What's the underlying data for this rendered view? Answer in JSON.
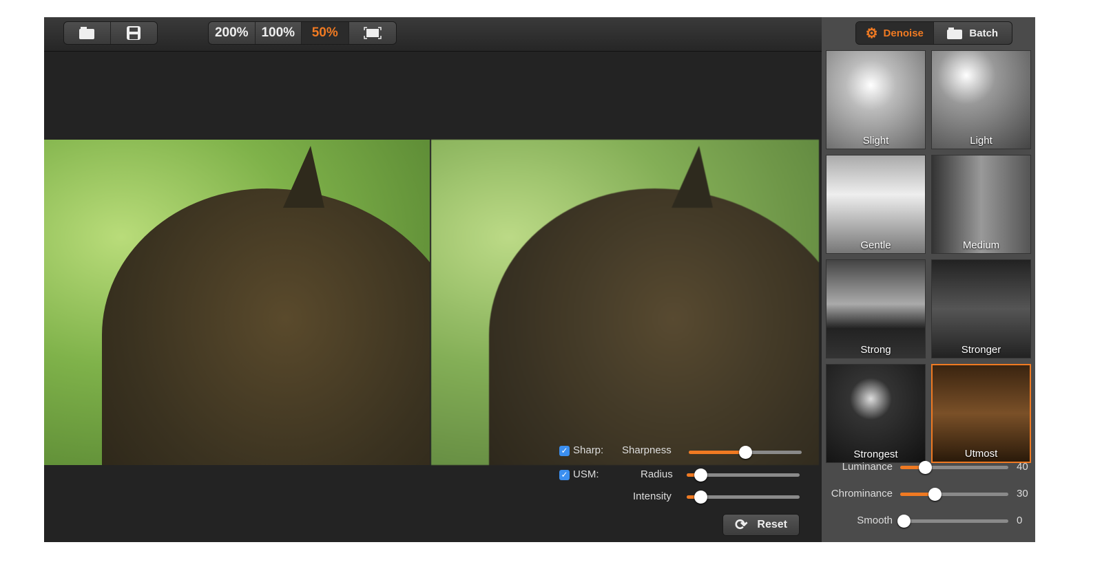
{
  "toolbar": {
    "open_icon": "folder-icon",
    "save_icon": "floppy-disk-icon",
    "zoom": [
      "200%",
      "100%",
      "50%"
    ],
    "active_zoom": "50%",
    "fit_icon": "fit-screen-icon"
  },
  "mode_tabs": {
    "denoise": "Denoise",
    "batch": "Batch",
    "active": "Denoise"
  },
  "sharp": {
    "checkbox_label": "Sharp:",
    "checked": true,
    "sharpness_label": "Sharpness",
    "sharpness": 50
  },
  "usm": {
    "checkbox_label": "USM:",
    "checked": true,
    "radius_label": "Radius",
    "radius": 12,
    "intensity_label": "Intensity",
    "intensity": 12
  },
  "reset_label": "Reset",
  "presets": [
    "Slight",
    "Light",
    "Gentle",
    "Medium",
    "Strong",
    "Stronger",
    "Strongest",
    "Utmost"
  ],
  "selected_preset": "Utmost",
  "denoise_sliders": [
    {
      "label": "Luminance",
      "value": "40",
      "position": 23
    },
    {
      "label": "Chrominance",
      "value": "30",
      "position": 32
    },
    {
      "label": "Smooth",
      "value": "0",
      "position": 0
    }
  ],
  "colors": {
    "accent": "#f07a22",
    "checkbox": "#3b8ff0"
  }
}
